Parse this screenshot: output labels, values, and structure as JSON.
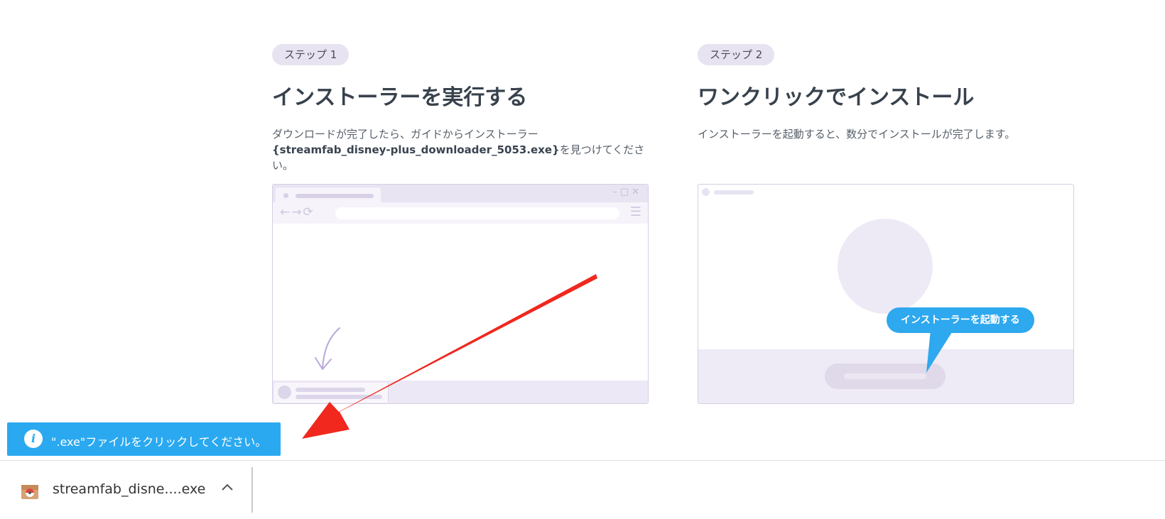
{
  "step1": {
    "badge": "ステップ 1",
    "title": "インストーラーを実行する",
    "desc_prefix": "ダウンロードが完了したら、ガイドからインストーラー",
    "filename": "{streamfab_disney-plus_downloader_5053.exe}",
    "desc_suffix": "を見つけてください。"
  },
  "step2": {
    "badge": "ステップ 2",
    "title": "ワンクリックでインストール",
    "desc": "インストーラーを起動すると、数分でインストールが完了します。",
    "callout": "インストーラーを起動する"
  },
  "toast": {
    "icon": "info-icon",
    "text": "\".exe\"ファイルをクリックしてください。"
  },
  "download_shelf": {
    "file_name": "streamfab_disne....exe",
    "file_icon": "installer-package-icon",
    "menu_icon": "chevron-up-icon"
  },
  "colors": {
    "accent_blue": "#2aa9f0",
    "arrow_red": "#f0281e",
    "badge_bg": "#e8e3f1",
    "illustration_lavender": "#e9e4f2"
  }
}
